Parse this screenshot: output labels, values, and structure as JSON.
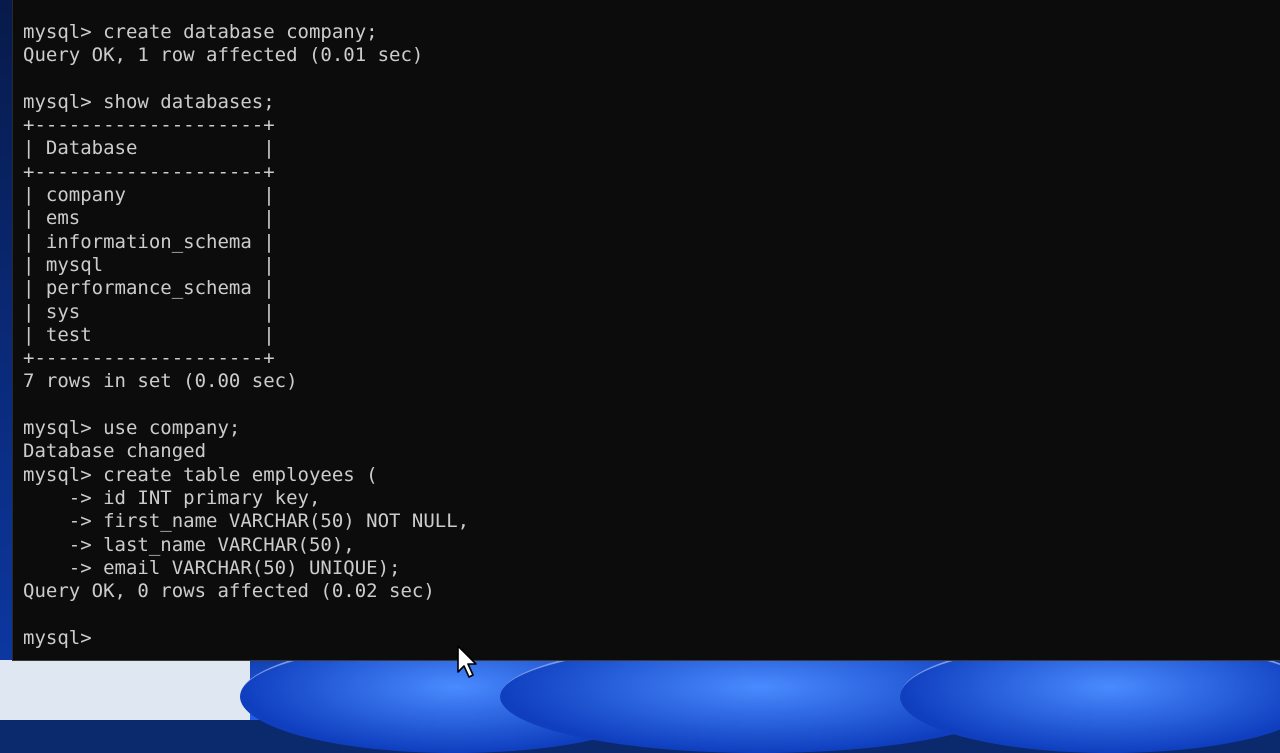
{
  "terminal": {
    "lines": [
      "mysql> create database company;",
      "Query OK, 1 row affected (0.01 sec)",
      "",
      "mysql> show databases;",
      "+--------------------+",
      "| Database           |",
      "+--------------------+",
      "| company            |",
      "| ems                |",
      "| information_schema |",
      "| mysql              |",
      "| performance_schema |",
      "| sys                |",
      "| test               |",
      "+--------------------+",
      "7 rows in set (0.00 sec)",
      "",
      "mysql> use company;",
      "Database changed",
      "mysql> create table employees (",
      "    -> id INT primary key,",
      "    -> first_name VARCHAR(50) NOT NULL,",
      "    -> last_name VARCHAR(50),",
      "    -> email VARCHAR(50) UNIQUE);",
      "Query OK, 0 rows affected (0.02 sec)",
      "",
      "mysql> "
    ]
  },
  "colors": {
    "terminal_background": "#0c0c0c",
    "terminal_text": "#cccccc",
    "wallpaper_blue": "#1f5cff"
  },
  "icons": {
    "mouse_pointer": "mouse-pointer-icon"
  }
}
